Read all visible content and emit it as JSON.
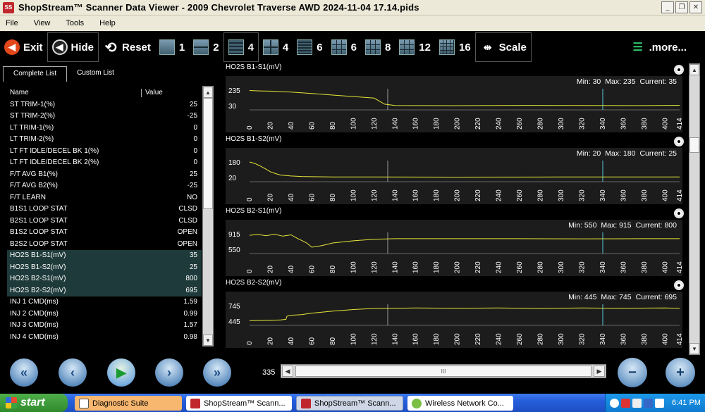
{
  "window": {
    "title": "ShopStream™ Scanner Data Viewer - 2009 Chevrolet Traverse  AWD  2024-11-04 17.14.pids",
    "icon_label": "SS",
    "min_label": "_",
    "max_label": "❐",
    "close_label": "✕"
  },
  "menu": [
    "File",
    "View",
    "Tools",
    "Help"
  ],
  "toolbar": {
    "exit": "Exit",
    "hide": "Hide",
    "reset": "Reset",
    "layouts": [
      "1",
      "2",
      "4",
      "4",
      "6",
      "6",
      "8",
      "12",
      "16"
    ],
    "scale": "Scale",
    "more": ".more..."
  },
  "tabs": {
    "complete": "Complete List",
    "custom": "Custom List"
  },
  "list_headers": {
    "name": "Name",
    "value": "Value"
  },
  "pids": [
    {
      "name": "ST TRIM-1(%)",
      "value": "25",
      "hl": false
    },
    {
      "name": "ST TRIM-2(%)",
      "value": "-25",
      "hl": false
    },
    {
      "name": "LT TRIM-1(%)",
      "value": "0",
      "hl": false
    },
    {
      "name": "LT TRIM-2(%)",
      "value": "0",
      "hl": false
    },
    {
      "name": "LT FT IDLE/DECEL BK 1(%)",
      "value": "0",
      "hl": false
    },
    {
      "name": "LT FT IDLE/DECEL BK 2(%)",
      "value": "0",
      "hl": false
    },
    {
      "name": "F/T AVG B1(%)",
      "value": "25",
      "hl": false
    },
    {
      "name": "F/T AVG B2(%)",
      "value": "-25",
      "hl": false
    },
    {
      "name": "F/T LEARN",
      "value": "NO",
      "hl": false
    },
    {
      "name": "B1S1 LOOP STAT",
      "value": "CLSD",
      "hl": false
    },
    {
      "name": "B2S1 LOOP STAT",
      "value": "CLSD",
      "hl": false
    },
    {
      "name": "B1S2 LOOP STAT",
      "value": "OPEN",
      "hl": false
    },
    {
      "name": "B2S2 LOOP STAT",
      "value": "OPEN",
      "hl": false
    },
    {
      "name": "HO2S B1-S1(mV)",
      "value": "35",
      "hl": true
    },
    {
      "name": "HO2S B1-S2(mV)",
      "value": "25",
      "hl": true
    },
    {
      "name": "HO2S B2-S1(mV)",
      "value": "800",
      "hl": true
    },
    {
      "name": "HO2S B2-S2(mV)",
      "value": "695",
      "hl": true
    },
    {
      "name": "INJ 1 CMD(ms)",
      "value": "1.59",
      "hl": false
    },
    {
      "name": "INJ 2 CMD(ms)",
      "value": "0.99",
      "hl": false
    },
    {
      "name": "INJ 3 CMD(ms)",
      "value": "1.57",
      "hl": false
    },
    {
      "name": "INJ 4 CMD(ms)",
      "value": "0.98",
      "hl": false
    }
  ],
  "chart_data": [
    {
      "type": "line",
      "title": "HO2S B1-S1(mV)",
      "min_label": "Min: 30",
      "max_label": "Max: 235",
      "current_label": "Current: 35",
      "ylim": [
        30,
        235
      ],
      "yticks": [
        "235",
        "30"
      ],
      "xticks": [
        "0",
        "20",
        "40",
        "60",
        "80",
        "100",
        "120",
        "140",
        "160",
        "180",
        "200",
        "220",
        "240",
        "260",
        "280",
        "300",
        "320",
        "340",
        "360",
        "380",
        "400",
        "414"
      ],
      "xlim": [
        0,
        414
      ],
      "cursor_x": [
        133,
        340
      ],
      "series": [
        {
          "x": [
            0,
            10,
            20,
            30,
            40,
            60,
            80,
            100,
            120,
            130,
            140,
            200,
            260,
            320,
            380,
            414
          ],
          "values": [
            230,
            225,
            222,
            215,
            210,
            190,
            170,
            150,
            130,
            50,
            32,
            30,
            34,
            33,
            31,
            35
          ]
        }
      ]
    },
    {
      "type": "line",
      "title": "HO2S B1-S2(mV)",
      "min_label": "Min: 20",
      "max_label": "Max: 180",
      "current_label": "Current: 25",
      "ylim": [
        20,
        180
      ],
      "yticks": [
        "180",
        "20"
      ],
      "xticks": [
        "0",
        "20",
        "40",
        "60",
        "80",
        "100",
        "120",
        "140",
        "160",
        "180",
        "200",
        "220",
        "240",
        "260",
        "280",
        "300",
        "320",
        "340",
        "360",
        "380",
        "400",
        "414"
      ],
      "xlim": [
        0,
        414
      ],
      "cursor_x": [
        133,
        340
      ],
      "series": [
        {
          "x": [
            0,
            5,
            10,
            15,
            20,
            25,
            30,
            40,
            50,
            60,
            80,
            120,
            200,
            300,
            414
          ],
          "values": [
            180,
            165,
            140,
            110,
            80,
            60,
            45,
            35,
            30,
            28,
            26,
            25,
            24,
            25,
            25
          ]
        }
      ]
    },
    {
      "type": "line",
      "title": "HO2S B2-S1(mV)",
      "min_label": "Min: 550",
      "max_label": "Max: 915",
      "current_label": "Current: 800",
      "ylim": [
        550,
        915
      ],
      "yticks": [
        "915",
        "550"
      ],
      "xticks": [
        "0",
        "20",
        "40",
        "60",
        "80",
        "100",
        "120",
        "140",
        "160",
        "180",
        "200",
        "220",
        "240",
        "260",
        "280",
        "300",
        "320",
        "340",
        "360",
        "380",
        "400",
        "414"
      ],
      "xlim": [
        0,
        414
      ],
      "cursor_x": [
        133,
        340
      ],
      "series": [
        {
          "x": [
            0,
            8,
            16,
            24,
            32,
            40,
            45,
            50,
            55,
            60,
            70,
            80,
            100,
            120,
            140,
            200,
            260,
            320,
            380,
            414
          ],
          "values": [
            880,
            900,
            870,
            905,
            860,
            890,
            820,
            760,
            700,
            600,
            640,
            700,
            750,
            785,
            800,
            800,
            800,
            798,
            800,
            800
          ]
        }
      ]
    },
    {
      "type": "line",
      "title": "HO2S B2-S2(mV)",
      "min_label": "Min: 445",
      "max_label": "Max: 745",
      "current_label": "Current: 695",
      "ylim": [
        445,
        745
      ],
      "yticks": [
        "745",
        "445"
      ],
      "xticks": [
        "0",
        "20",
        "40",
        "60",
        "80",
        "100",
        "120",
        "140",
        "160",
        "180",
        "200",
        "220",
        "240",
        "260",
        "280",
        "300",
        "320",
        "340",
        "360",
        "380",
        "400",
        "414"
      ],
      "xlim": [
        0,
        414
      ],
      "cursor_x": [
        133,
        340
      ],
      "series": [
        {
          "x": [
            0,
            20,
            30,
            35,
            36,
            40,
            50,
            60,
            80,
            100,
            120,
            140,
            160,
            200,
            240,
            280,
            320,
            360,
            400,
            414
          ],
          "values": [
            455,
            460,
            470,
            480,
            540,
            560,
            570,
            600,
            640,
            670,
            690,
            695,
            700,
            695,
            700,
            690,
            700,
            695,
            700,
            695
          ]
        }
      ]
    }
  ],
  "navigation": {
    "position": "335",
    "scroll_grip": "III"
  },
  "taskbar": {
    "start": "start",
    "tasks": [
      "Diagnostic Suite",
      "ShopStream™ Scann...",
      "ShopStream™ Scann...",
      "Wireless Network Co..."
    ],
    "clock": "6:41 PM"
  }
}
